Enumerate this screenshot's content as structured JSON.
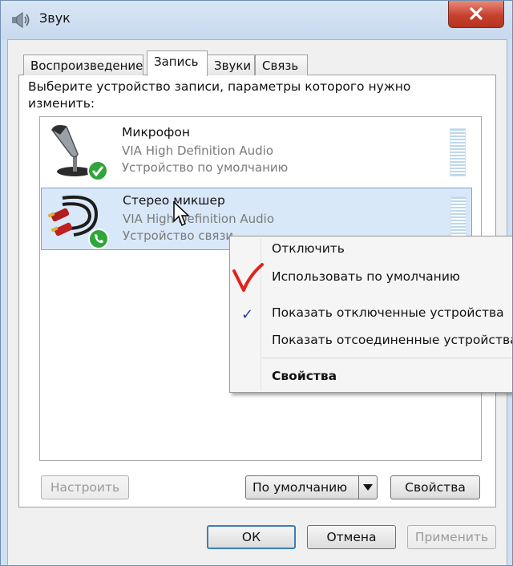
{
  "window": {
    "title": "Звук",
    "app_icon": "speaker-icon",
    "close_icon": "close-icon"
  },
  "tabs": [
    {
      "label": "Воспроизведение",
      "active": false
    },
    {
      "label": "Запись",
      "active": true
    },
    {
      "label": "Звуки",
      "active": false
    },
    {
      "label": "Связь",
      "active": false
    }
  ],
  "instruction": "Выберите устройство записи, параметры которого нужно изменить:",
  "devices": [
    {
      "name": "Микрофон",
      "driver": "VIA High Definition Audio",
      "status": "Устройство по умолчанию",
      "icon": "microphone-icon",
      "badge": "check-badge-icon",
      "selected": false
    },
    {
      "name": "Стерео микшер",
      "driver": "VIA High Definition Audio",
      "status": "Устройство связи",
      "icon": "rca-cable-icon",
      "badge": "phone-badge-icon",
      "selected": true
    }
  ],
  "buttons": {
    "configure": "Настроить",
    "set_default": "По умолчанию",
    "properties": "Свойства",
    "ok": "ОК",
    "cancel": "Отмена",
    "apply": "Применить"
  },
  "context_menu": {
    "items": [
      {
        "label": "Отключить",
        "checked": false
      },
      {
        "label": "Использовать по умолчанию",
        "checked": false
      },
      {
        "label": "Показать отключенные устройства",
        "checked": true
      },
      {
        "label": "Показать отсоединенные устройства",
        "checked": false
      },
      {
        "label": "Свойства",
        "checked": false,
        "bold": true
      }
    ],
    "check_glyph": "✓"
  },
  "colors": {
    "selection": "#d9e8f9",
    "annotation": "#e0231b",
    "close_button": "#c6422e",
    "default_button_border": "#3c7fb1"
  }
}
